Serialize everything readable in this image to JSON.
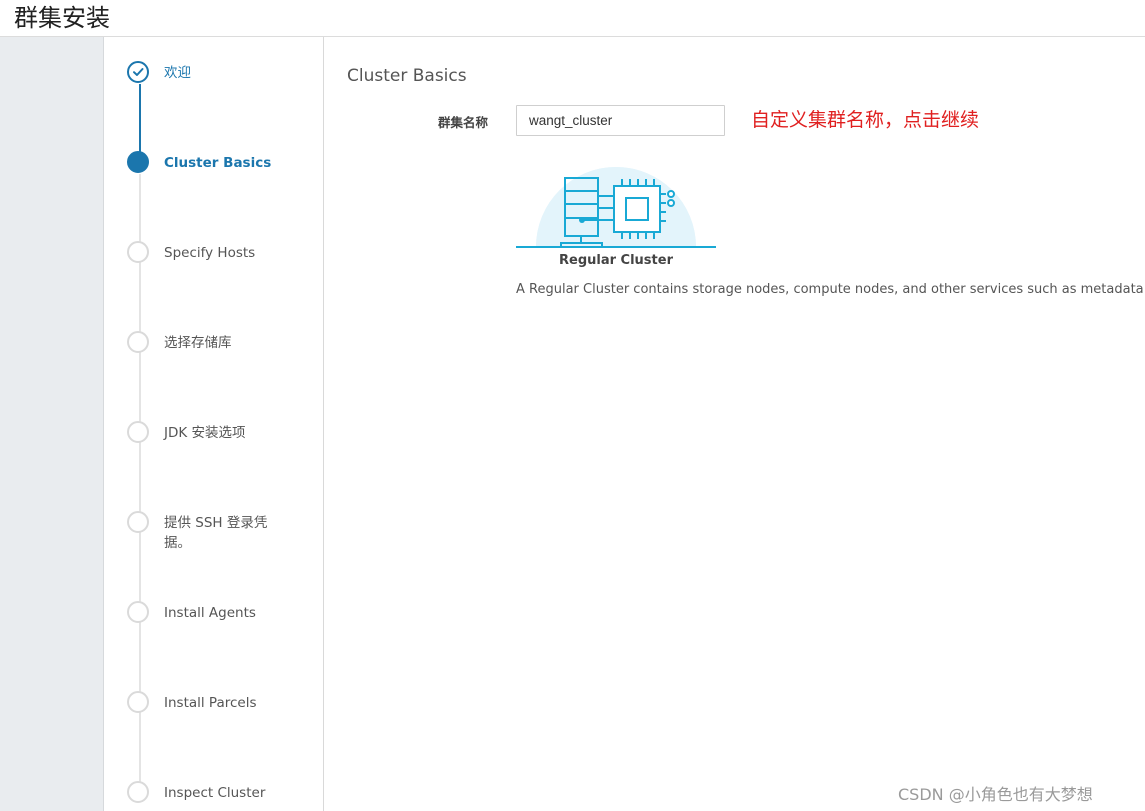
{
  "header": {
    "title": "群集安装"
  },
  "steps": [
    {
      "label": "欢迎",
      "state": "done"
    },
    {
      "label": "Cluster Basics",
      "state": "current"
    },
    {
      "label": "Specify Hosts",
      "state": "pending"
    },
    {
      "label": "选择存储库",
      "state": "pending"
    },
    {
      "label": "JDK 安装选项",
      "state": "pending"
    },
    {
      "label": "提供 SSH 登录凭据。",
      "state": "pending"
    },
    {
      "label": "Install Agents",
      "state": "pending"
    },
    {
      "label": "Install Parcels",
      "state": "pending"
    },
    {
      "label": "Inspect Cluster",
      "state": "pending"
    }
  ],
  "main": {
    "section_title": "Cluster Basics",
    "cluster_name_label": "群集名称",
    "cluster_name_value": "wangt_cluster",
    "annotation": "自定义集群名称，点击继续",
    "option_title": "Regular Cluster",
    "option_description": "A Regular Cluster contains storage nodes, compute nodes, and other services such as metadata and s"
  },
  "watermark": "CSDN @小角色也有大梦想",
  "colors": {
    "accent": "#1b76ad",
    "annotation": "#e02020",
    "illustration": "#19a9d5"
  }
}
